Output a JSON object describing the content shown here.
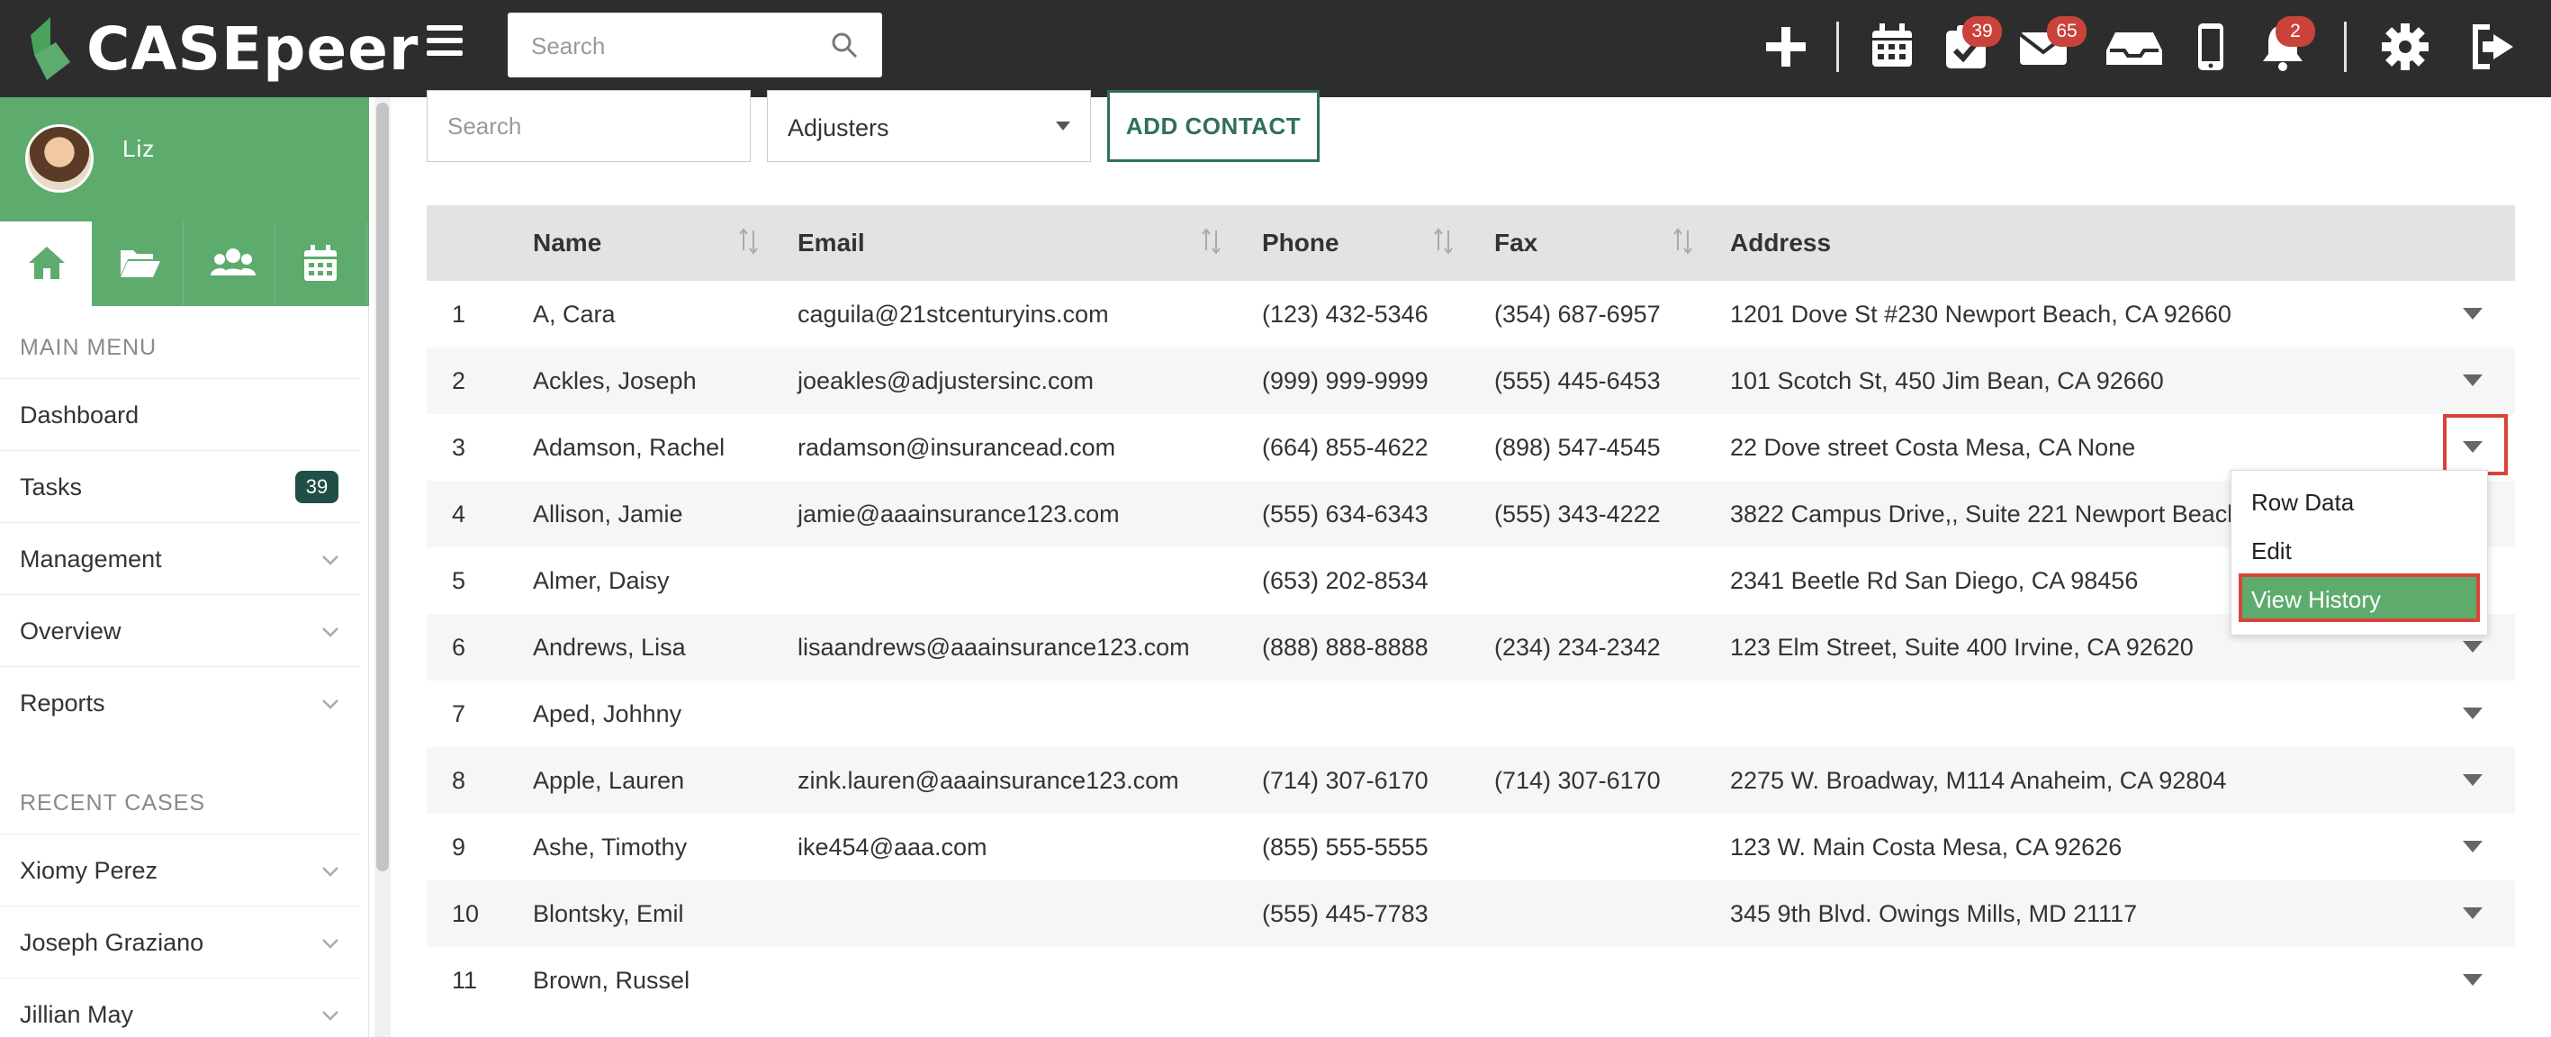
{
  "app": {
    "logo_text": "CASEpeer"
  },
  "topbar": {
    "search_placeholder": "Search",
    "badges": {
      "tasks": "39",
      "mail": "65",
      "notifications": "2"
    },
    "colors": {
      "background": "#2d2d2d",
      "badge": "#c9433b"
    }
  },
  "sidebar": {
    "user_name": "Liz",
    "main_menu_label": "MAIN MENU",
    "menu": [
      {
        "label": "Dashboard"
      },
      {
        "label": "Tasks",
        "badge": "39"
      },
      {
        "label": "Management"
      },
      {
        "label": "Overview"
      },
      {
        "label": "Reports"
      }
    ],
    "recent_cases_label": "RECENT CASES",
    "recent_cases": [
      {
        "label": "Xiomy Perez"
      },
      {
        "label": "Joseph Graziano"
      },
      {
        "label": "Jillian May"
      }
    ],
    "colors": {
      "accent": "#5eab6e",
      "badge": "#1f4f45"
    }
  },
  "filters": {
    "search_placeholder": "Search",
    "type_selected": "Adjusters",
    "add_contact_label": "ADD CONTACT"
  },
  "table": {
    "headers": {
      "name": "Name",
      "email": "Email",
      "phone": "Phone",
      "fax": "Fax",
      "address": "Address"
    },
    "rows": [
      {
        "num": "1",
        "name": "A, Cara",
        "email": "caguila@21stcenturyins.com",
        "phone": "(123) 432-5346",
        "fax": "(354) 687-6957",
        "address": "1201 Dove St #230 Newport Beach, CA 92660"
      },
      {
        "num": "2",
        "name": "Ackles, Joseph",
        "email": "joeakles@adjustersinc.com",
        "phone": "(999) 999-9999",
        "fax": "(555) 445-6453",
        "address": "101 Scotch St, 450 Jim Bean, CA 92660"
      },
      {
        "num": "3",
        "name": "Adamson, Rachel",
        "email": "radamson@insurancead.com",
        "phone": "(664) 855-4622",
        "fax": "(898) 547-4545",
        "address": "22 Dove street Costa Mesa, CA None"
      },
      {
        "num": "4",
        "name": "Allison, Jamie",
        "email": "jamie@aaainsurance123.com",
        "phone": "(555) 634-6343",
        "fax": "(555) 343-4222",
        "address": "3822 Campus Drive,, Suite 221 Newport Beach,"
      },
      {
        "num": "5",
        "name": "Almer, Daisy",
        "email": "",
        "phone": "(653) 202-8534",
        "fax": "",
        "address": "2341 Beetle Rd San Diego, CA 98456"
      },
      {
        "num": "6",
        "name": "Andrews, Lisa",
        "email": "lisaandrews@aaainsurance123.com",
        "phone": "(888) 888-8888",
        "fax": "(234) 234-2342",
        "address": "123 Elm Street, Suite 400 Irvine, CA 92620"
      },
      {
        "num": "7",
        "name": "Aped, Johhny",
        "email": "",
        "phone": "",
        "fax": "",
        "address": ""
      },
      {
        "num": "8",
        "name": "Apple, Lauren",
        "email": "zink.lauren@aaainsurance123.com",
        "phone": "(714) 307-6170",
        "fax": "(714) 307-6170",
        "address": "2275 W. Broadway, M114 Anaheim, CA 92804"
      },
      {
        "num": "9",
        "name": "Ashe, Timothy",
        "email": "ike454@aaa.com",
        "phone": "(855) 555-5555",
        "fax": "",
        "address": "123 W. Main Costa Mesa, CA 92626"
      },
      {
        "num": "10",
        "name": "Blontsky, Emil",
        "email": "",
        "phone": "(555) 445-7783",
        "fax": "",
        "address": "345 9th Blvd. Owings Mills, MD 21117"
      },
      {
        "num": "11",
        "name": "Brown, Russel",
        "email": "",
        "phone": "",
        "fax": "",
        "address": ""
      }
    ]
  },
  "row_menu": {
    "items": [
      {
        "label": "Row Data"
      },
      {
        "label": "Edit"
      },
      {
        "label": "View History"
      }
    ],
    "highlight_color": "#d9443a"
  }
}
